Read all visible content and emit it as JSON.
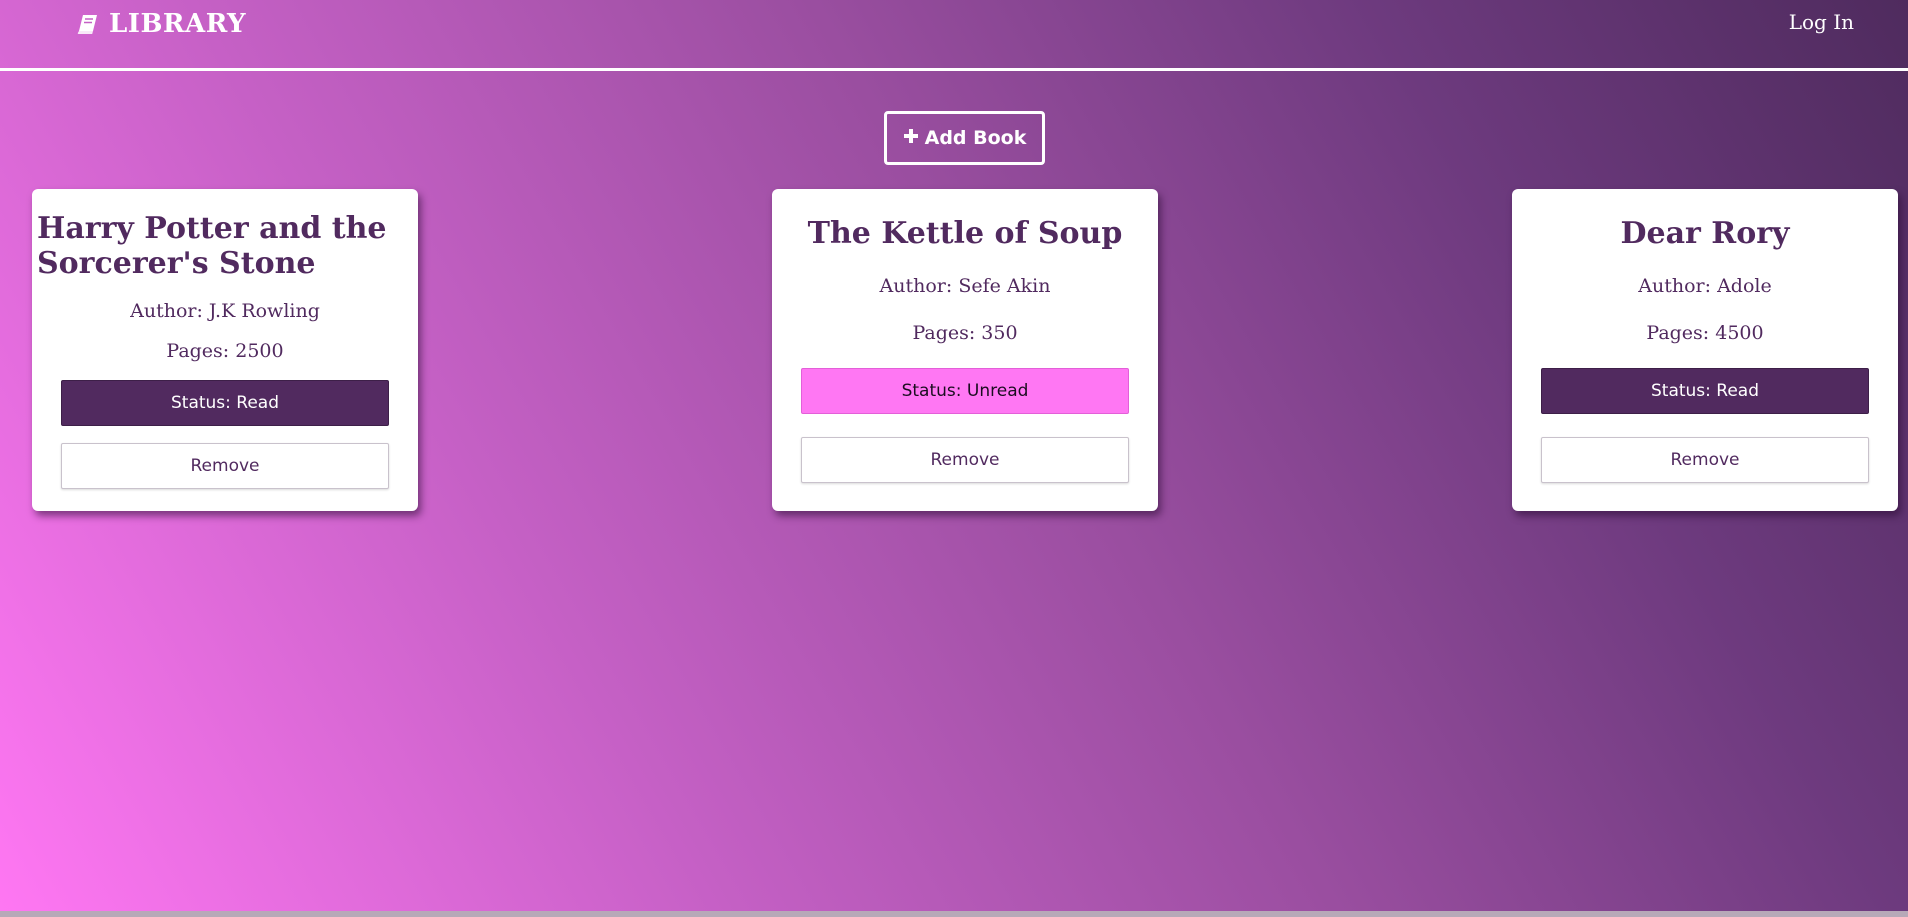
{
  "header": {
    "brand_label": "LIBRARY",
    "brand_icon": "book-icon",
    "login_label": "Log In"
  },
  "actions": {
    "add_book_label": "Add Book",
    "add_icon": "plus-icon"
  },
  "books": [
    {
      "title": "Harry Potter and the Sorcerer's Stone",
      "author": "Author: J.K Rowling",
      "pages": "Pages: 2500",
      "status": "Status: Read",
      "remove_label": "Remove"
    },
    {
      "title": "The Kettle of Soup",
      "author": "Author: Sefe Akin",
      "pages": "Pages: 350",
      "status": "Status: Unread",
      "remove_label": "Remove"
    },
    {
      "title": "Dear Rory",
      "author": "Author: Adole",
      "pages": "Pages: 4500",
      "status": "Status: Read",
      "remove_label": "Remove"
    }
  ],
  "colors": {
    "primary_purple": "#512a5f",
    "unread_pink": "#ff77f3",
    "card_bg": "#ffffff"
  }
}
